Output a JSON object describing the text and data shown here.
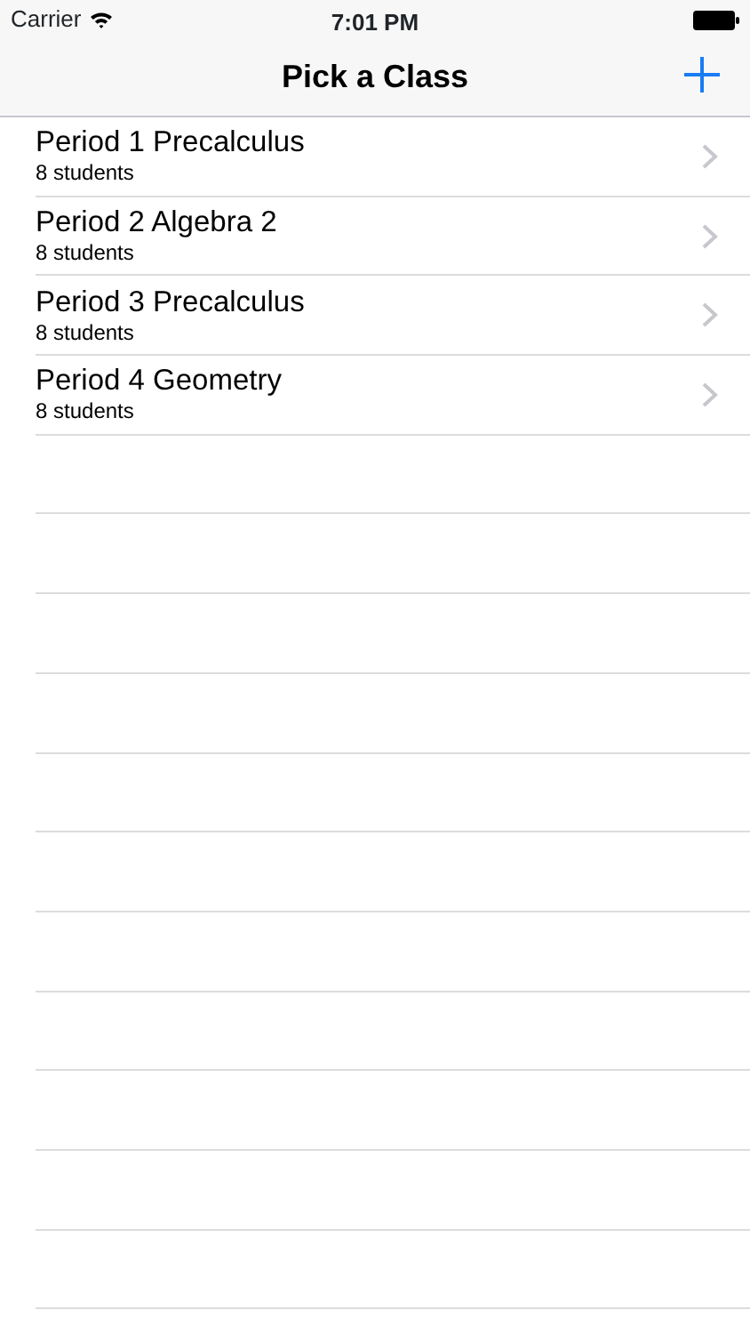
{
  "status_bar": {
    "carrier": "Carrier",
    "time": "7:01 PM"
  },
  "nav_bar": {
    "title": "Pick a Class"
  },
  "classes": [
    {
      "name": "Period 1 Precalculus",
      "detail": "8 students"
    },
    {
      "name": "Period 2 Algebra 2",
      "detail": "8 students"
    },
    {
      "name": "Period 3 Precalculus",
      "detail": "8 students"
    },
    {
      "name": "Period 4 Geometry",
      "detail": "8 students"
    }
  ]
}
